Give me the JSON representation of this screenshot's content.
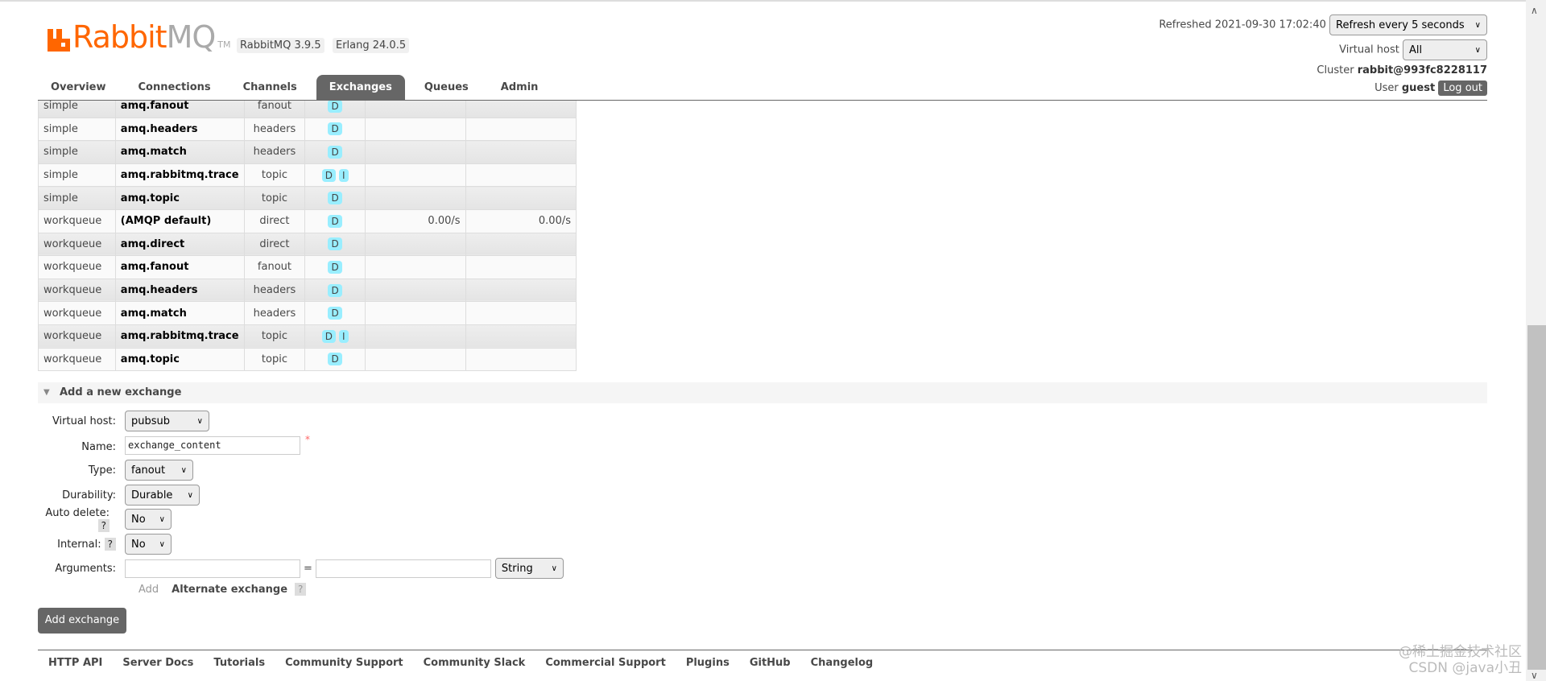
{
  "header": {
    "logo_text_orange": "Rabbit",
    "logo_text_gray": "MQ",
    "logo_tm": "TM",
    "version_badge": "RabbitMQ 3.9.5",
    "erlang_badge": "Erlang 24.0.5"
  },
  "nav": {
    "tabs": [
      "Overview",
      "Connections",
      "Channels",
      "Exchanges",
      "Queues",
      "Admin"
    ],
    "active": "Exchanges"
  },
  "status": {
    "refreshed": "Refreshed 2021-09-30 17:02:40",
    "refresh_select": "Refresh every 5 seconds",
    "vhost_label": "Virtual host",
    "vhost_select": "All",
    "cluster_label": "Cluster",
    "cluster_name": "rabbit@993fc8228117",
    "user_label": "User",
    "user_name": "guest",
    "logout": "Log out"
  },
  "exchanges": [
    {
      "vhost": "simple",
      "name": "amq.fanout",
      "type": "fanout",
      "features": [
        "D"
      ],
      "rate_in": "",
      "rate_out": ""
    },
    {
      "vhost": "simple",
      "name": "amq.headers",
      "type": "headers",
      "features": [
        "D"
      ],
      "rate_in": "",
      "rate_out": ""
    },
    {
      "vhost": "simple",
      "name": "amq.match",
      "type": "headers",
      "features": [
        "D"
      ],
      "rate_in": "",
      "rate_out": ""
    },
    {
      "vhost": "simple",
      "name": "amq.rabbitmq.trace",
      "type": "topic",
      "features": [
        "D",
        "I"
      ],
      "rate_in": "",
      "rate_out": ""
    },
    {
      "vhost": "simple",
      "name": "amq.topic",
      "type": "topic",
      "features": [
        "D"
      ],
      "rate_in": "",
      "rate_out": ""
    },
    {
      "vhost": "workqueue",
      "name": "(AMQP default)",
      "type": "direct",
      "features": [
        "D"
      ],
      "rate_in": "0.00/s",
      "rate_out": "0.00/s"
    },
    {
      "vhost": "workqueue",
      "name": "amq.direct",
      "type": "direct",
      "features": [
        "D"
      ],
      "rate_in": "",
      "rate_out": ""
    },
    {
      "vhost": "workqueue",
      "name": "amq.fanout",
      "type": "fanout",
      "features": [
        "D"
      ],
      "rate_in": "",
      "rate_out": ""
    },
    {
      "vhost": "workqueue",
      "name": "amq.headers",
      "type": "headers",
      "features": [
        "D"
      ],
      "rate_in": "",
      "rate_out": ""
    },
    {
      "vhost": "workqueue",
      "name": "amq.match",
      "type": "headers",
      "features": [
        "D"
      ],
      "rate_in": "",
      "rate_out": ""
    },
    {
      "vhost": "workqueue",
      "name": "amq.rabbitmq.trace",
      "type": "topic",
      "features": [
        "D",
        "I"
      ],
      "rate_in": "",
      "rate_out": ""
    },
    {
      "vhost": "workqueue",
      "name": "amq.topic",
      "type": "topic",
      "features": [
        "D"
      ],
      "rate_in": "",
      "rate_out": ""
    }
  ],
  "form": {
    "title": "Add a new exchange",
    "vhost_label": "Virtual host:",
    "vhost_value": "pubsub",
    "name_label": "Name:",
    "name_value": "exchange_content",
    "required": "*",
    "type_label": "Type:",
    "type_value": "fanout",
    "durability_label": "Durability:",
    "durability_value": "Durable",
    "autodelete_label": "Auto delete:",
    "autodelete_value": "No",
    "internal_label": "Internal:",
    "internal_value": "No",
    "arguments_label": "Arguments:",
    "arg_key": "",
    "arg_value": "",
    "equals": "=",
    "arg_type": "String",
    "add_link": "Add",
    "alternate_exchange": "Alternate exchange",
    "help": "?",
    "submit": "Add exchange"
  },
  "footer": [
    "HTTP API",
    "Server Docs",
    "Tutorials",
    "Community Support",
    "Community Slack",
    "Commercial Support",
    "Plugins",
    "GitHub",
    "Changelog"
  ],
  "watermark": [
    "@稀土掘金技术社区",
    "CSDN @java小丑"
  ],
  "colors": {
    "brand": "#ff6600",
    "active_tab": "#666666",
    "feature_badge": "#99eeff"
  }
}
